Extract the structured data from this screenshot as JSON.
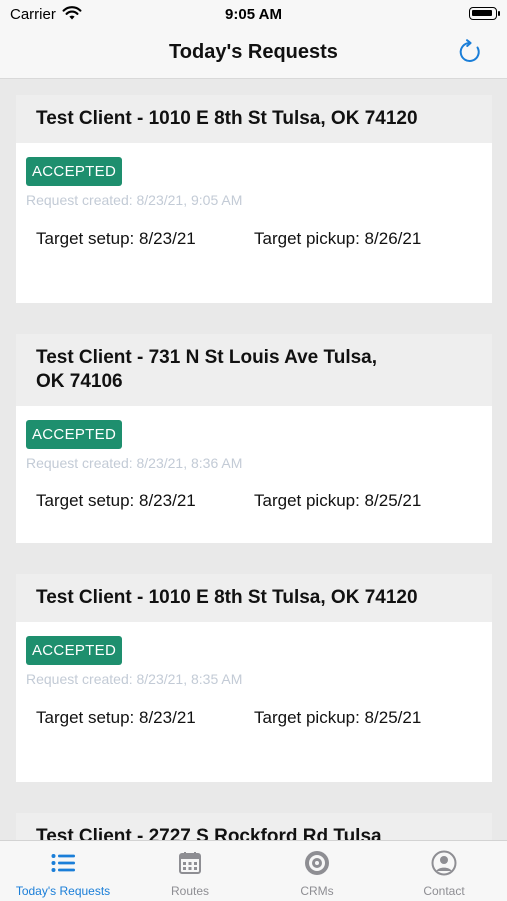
{
  "status_bar": {
    "carrier": "Carrier",
    "time": "9:05 AM"
  },
  "nav": {
    "title": "Today's Requests",
    "refresh_icon": "refresh-icon"
  },
  "requests": [
    {
      "header": "Test Client - 1010 E 8th St Tulsa, OK 74120",
      "status": "ACCEPTED",
      "created": "Request created: 8/23/21, 9:05 AM",
      "target_setup": "Target setup: 8/23/21",
      "target_pickup": "Target pickup: 8/26/21"
    },
    {
      "header": "Test Client - 731 N St Louis Ave Tulsa, OK 74106",
      "status": "ACCEPTED",
      "created": "Request created: 8/23/21, 8:36 AM",
      "target_setup": "Target setup: 8/23/21",
      "target_pickup": "Target pickup: 8/25/21"
    },
    {
      "header": "Test Client - 1010 E 8th St Tulsa, OK 74120",
      "status": "ACCEPTED",
      "created": "Request created: 8/23/21, 8:35 AM",
      "target_setup": "Target setup: 8/23/21",
      "target_pickup": "Target pickup: 8/25/21"
    },
    {
      "header": "Test Client - 2727 S Rockford Rd Tulsa"
    }
  ],
  "tabs": [
    {
      "label": "Today's Requests",
      "icon": "list-icon",
      "active": true
    },
    {
      "label": "Routes",
      "icon": "calendar-icon",
      "active": false
    },
    {
      "label": "CRMs",
      "icon": "target-icon",
      "active": false
    },
    {
      "label": "Contact",
      "icon": "person-icon",
      "active": false
    }
  ],
  "colors": {
    "accent": "#1a7ed8",
    "accepted_badge": "#1e8f6e",
    "inactive_tab": "#8e8e93",
    "background": "#e9e9e9"
  }
}
